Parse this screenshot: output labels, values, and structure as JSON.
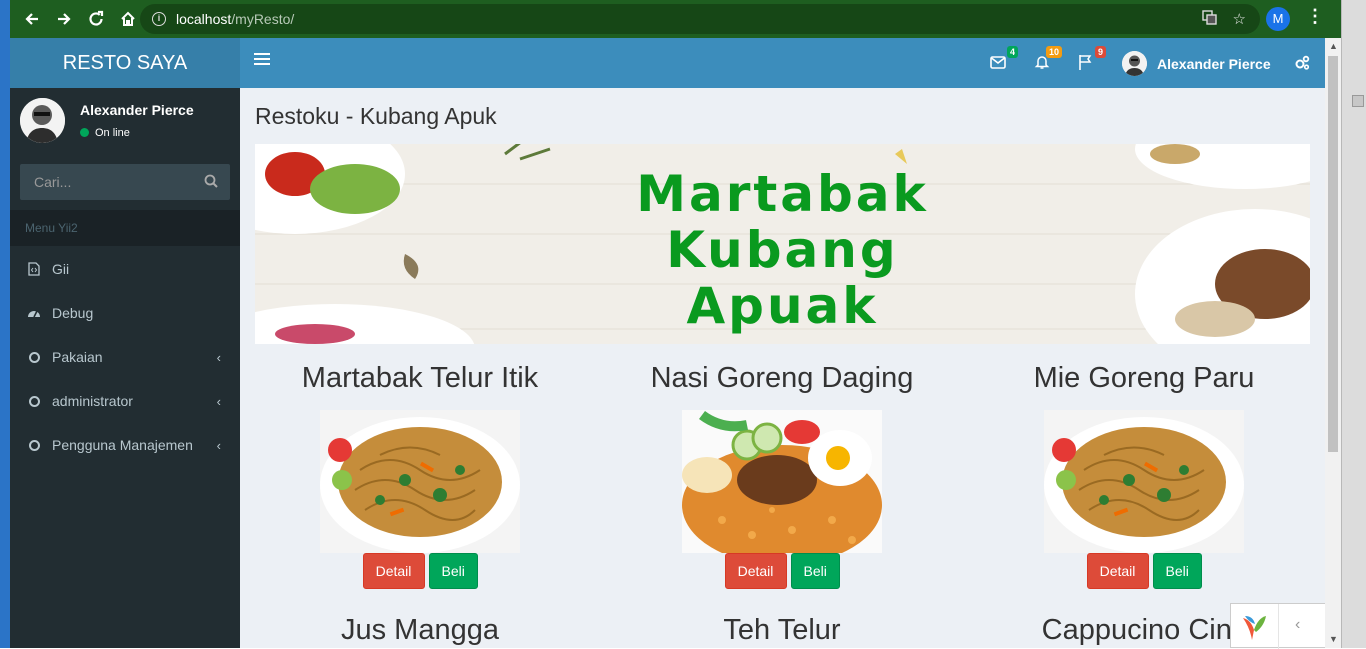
{
  "browser": {
    "url_host": "localhost",
    "url_path": "/myResto/",
    "profile_initial": "M"
  },
  "app": {
    "logo": "RESTO SAYA",
    "user_name": "Alexander Pierce",
    "user_status": "On line",
    "search_placeholder": "Cari...",
    "notifications": {
      "messages": "4",
      "alerts": "10",
      "tasks": "9"
    }
  },
  "sidebar": {
    "header": "Menu Yii2",
    "items": [
      {
        "label": "Gii",
        "icon": "file-code-icon"
      },
      {
        "label": "Debug",
        "icon": "dashboard-icon"
      },
      {
        "label": "Pakaian",
        "icon": "circle-icon",
        "chevron": "‹"
      },
      {
        "label": "administrator",
        "icon": "circle-icon",
        "chevron": "‹"
      },
      {
        "label": "Pengguna Manajemen",
        "icon": "circle-icon",
        "chevron": "‹"
      }
    ]
  },
  "page": {
    "title": "Restoku - Kubang Apuk",
    "banner_lines": [
      "Martabak",
      "Kubang",
      "Apuak"
    ],
    "products": [
      {
        "name": "Martabak Telur Itik",
        "detail": "Detail",
        "buy": "Beli",
        "image": "mie-goreng-photo"
      },
      {
        "name": "Nasi Goreng Daging",
        "detail": "Detail",
        "buy": "Beli",
        "image": "nasi-goreng-photo"
      },
      {
        "name": "Mie Goreng Paru",
        "detail": "Detail",
        "buy": "Beli",
        "image": "mie-goreng-photo"
      },
      {
        "name": "Jus Mangga"
      },
      {
        "name": "Teh Telur"
      },
      {
        "name": "Cappucino Cinc"
      }
    ]
  },
  "colors": {
    "header": "#3c8dbc",
    "logo": "#367fa9",
    "sidebar": "#222d32",
    "content": "#ecf0f5",
    "detail_btn": "#dd4b39",
    "buy_btn": "#00a65a",
    "banner_text": "#0a9a1f"
  }
}
